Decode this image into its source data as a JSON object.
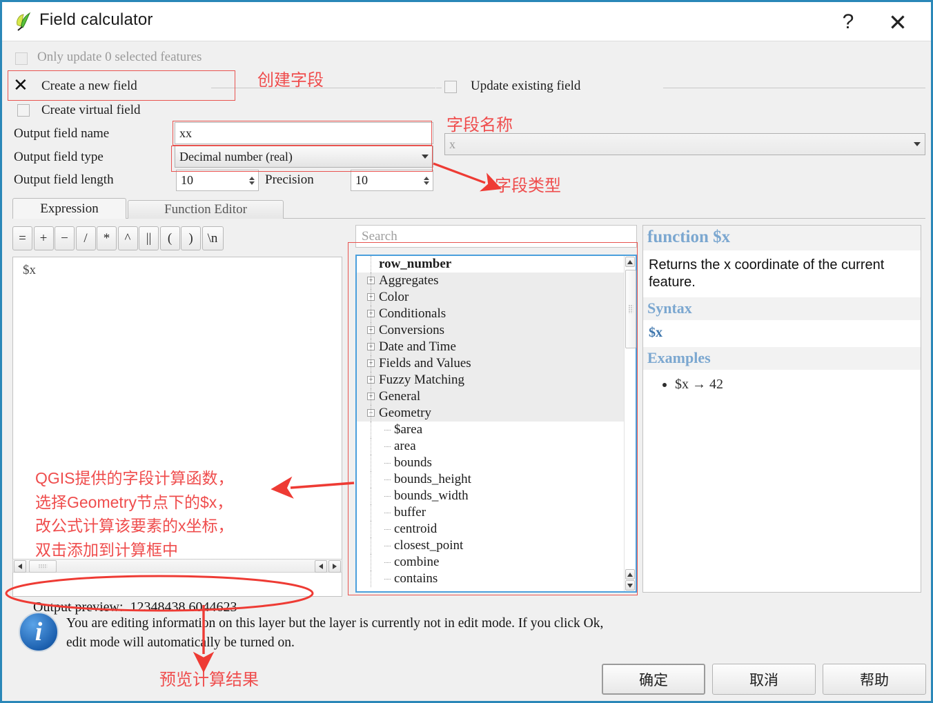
{
  "window": {
    "title": "Field calculator",
    "logo_icon": "qgis-logo-icon",
    "help_icon": "question-mark-icon",
    "close_icon": "close-icon"
  },
  "options": {
    "only_update_selected_label": "Only update 0 selected features",
    "only_update_selected_checked": false,
    "create_new_field_label": "Create a new field",
    "create_new_field_checked": true,
    "create_virtual_field_label": "Create virtual field",
    "create_virtual_field_checked": false,
    "update_existing_field_label": "Update existing field",
    "update_existing_field_checked": false,
    "update_existing_field_value": "x"
  },
  "fields": {
    "name_label": "Output field name",
    "name_value": "xx",
    "type_label": "Output field type",
    "type_value": "Decimal number (real)",
    "length_label": "Output field length",
    "length_value": "10",
    "precision_label": "Precision",
    "precision_value": "10"
  },
  "tabs": [
    {
      "label": "Expression",
      "active": true
    },
    {
      "label": "Function Editor",
      "active": false
    }
  ],
  "operators": [
    "=",
    "+",
    "−",
    "/",
    "*",
    "^",
    "||",
    "(",
    ")",
    "\\n"
  ],
  "expression": {
    "value": "$x"
  },
  "search": {
    "placeholder": "Search"
  },
  "tree": [
    {
      "label": "row_number",
      "type": "root-item",
      "bold": true,
      "toggle": ""
    },
    {
      "label": "Aggregates",
      "type": "category",
      "toggle": "+"
    },
    {
      "label": "Color",
      "type": "category",
      "toggle": "+"
    },
    {
      "label": "Conditionals",
      "type": "category",
      "toggle": "+"
    },
    {
      "label": "Conversions",
      "type": "category",
      "toggle": "+"
    },
    {
      "label": "Date and Time",
      "type": "category",
      "toggle": "+"
    },
    {
      "label": "Fields and Values",
      "type": "category",
      "toggle": "+"
    },
    {
      "label": "Fuzzy Matching",
      "type": "category",
      "toggle": "+"
    },
    {
      "label": "General",
      "type": "category",
      "toggle": "+"
    },
    {
      "label": "Geometry",
      "type": "category-expanded",
      "toggle": "−"
    },
    {
      "label": "$area",
      "type": "leaf"
    },
    {
      "label": "area",
      "type": "leaf"
    },
    {
      "label": "bounds",
      "type": "leaf"
    },
    {
      "label": "bounds_height",
      "type": "leaf"
    },
    {
      "label": "bounds_width",
      "type": "leaf"
    },
    {
      "label": "buffer",
      "type": "leaf"
    },
    {
      "label": "centroid",
      "type": "leaf"
    },
    {
      "label": "closest_point",
      "type": "leaf"
    },
    {
      "label": "combine",
      "type": "leaf"
    },
    {
      "label": "contains",
      "type": "leaf"
    }
  ],
  "help": {
    "title": "function $x",
    "description": "Returns the x coordinate of the current feature.",
    "syntax_heading": "Syntax",
    "syntax_body": "$x",
    "examples_heading": "Examples",
    "examples": [
      "$x → 42"
    ]
  },
  "output_preview": {
    "label": "Output preview:",
    "value": "12348438.6044623"
  },
  "info": {
    "icon": "info-icon",
    "line1": "You are editing information on this layer but the layer is currently not in edit mode. If you click Ok,",
    "line2": "edit mode will automatically be turned on."
  },
  "buttons": {
    "ok": "确定",
    "cancel": "取消",
    "help": "帮助"
  },
  "annotations": {
    "create_field": "创建字段",
    "field_name": "字段名称",
    "field_type": "字段类型",
    "functions_note": "QGIS提供的字段计算函数，\n选择Geometry节点下的$x，\n改公式计算该要素的x坐标，\n双击添加到计算框中",
    "preview_note": "预览计算结果"
  },
  "colors": {
    "window_border": "#2a87b8",
    "annotation_red": "#ef4d4d",
    "tree_focus_blue": "#4a9fdc",
    "help_heading_blue": "#7ba7d0"
  }
}
